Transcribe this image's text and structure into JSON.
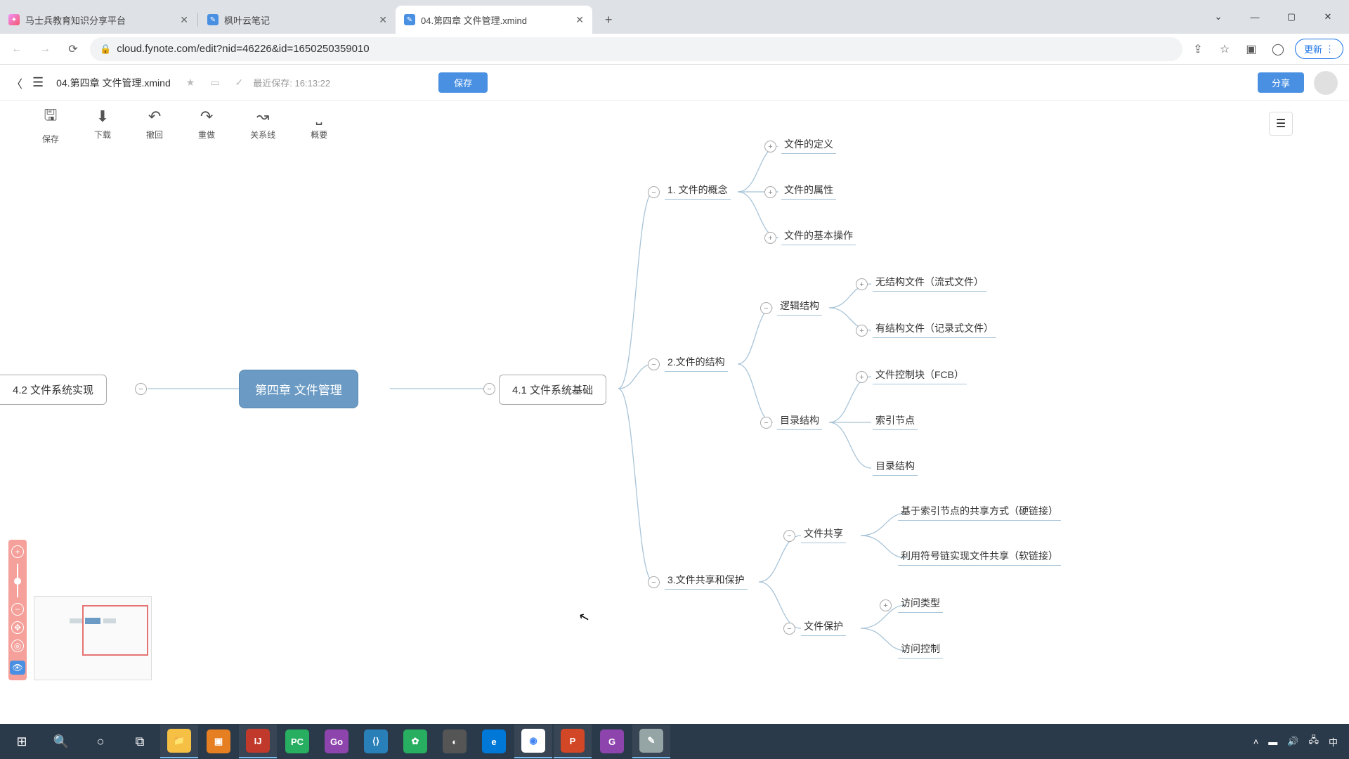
{
  "browser": {
    "tabs": [
      {
        "title": "马士兵教育知识分享平台",
        "active": false
      },
      {
        "title": "枫叶云笔记",
        "active": false
      },
      {
        "title": "04.第四章 文件管理.xmind",
        "active": true
      }
    ],
    "url": "cloud.fynote.com/edit?nid=46226&id=1650250359010",
    "update_label": "更新"
  },
  "app": {
    "filename": "04.第四章 文件管理.xmind",
    "autosave_prefix": "最近保存:",
    "autosave_time": "16:13:22",
    "save_label": "保存",
    "share_label": "分享"
  },
  "toolbar": {
    "save": "保存",
    "download": "下载",
    "undo": "撤回",
    "redo": "重做",
    "relation": "关系线",
    "summary": "概要"
  },
  "mindmap": {
    "root": "第四章 文件管理",
    "left_main": "4.2 文件系统实现",
    "right_main": "4.1 文件系统基础",
    "n1": "1. 文件的概念",
    "n1a": "文件的定义",
    "n1b": "文件的属性",
    "n1c": "文件的基本操作",
    "n2": "2.文件的结构",
    "n2a": "逻辑结构",
    "n2a1": "无结构文件（流式文件）",
    "n2a2": "有结构文件（记录式文件）",
    "n2b": "目录结构",
    "n2b1": "文件控制块（FCB）",
    "n2b2": "索引节点",
    "n2b3": "目录结构",
    "n3": "3.文件共享和保护",
    "n3a": "文件共享",
    "n3a1": "基于索引节点的共享方式（硬链接）",
    "n3a2": "利用符号链实现文件共享（软链接）",
    "n3b": "文件保护",
    "n3b1": "访问类型",
    "n3b2": "访问控制"
  },
  "tray": {
    "ime": "中"
  }
}
